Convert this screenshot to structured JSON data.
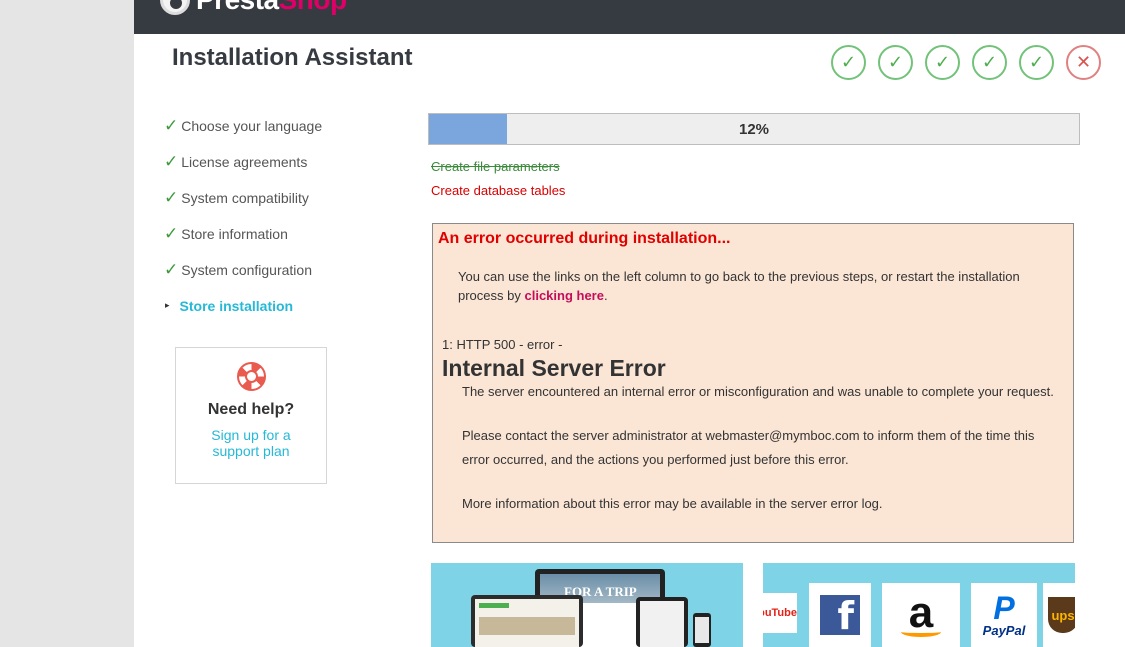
{
  "brand": {
    "logo_part1": "Presta",
    "logo_part2": "Shop"
  },
  "title": "Installation Assistant",
  "steps_indicator": [
    {
      "status": "done",
      "glyph": "✓"
    },
    {
      "status": "done",
      "glyph": "✓"
    },
    {
      "status": "done",
      "glyph": "✓"
    },
    {
      "status": "done",
      "glyph": "✓"
    },
    {
      "status": "done",
      "glyph": "✓"
    },
    {
      "status": "error",
      "glyph": "✕"
    }
  ],
  "nav": {
    "check_glyph": "✓",
    "arrow_glyph": "▸",
    "items": [
      {
        "label": "Choose your language"
      },
      {
        "label": "License agreements"
      },
      {
        "label": "System compatibility"
      },
      {
        "label": "Store information"
      },
      {
        "label": "System configuration"
      },
      {
        "label": "Store installation"
      }
    ]
  },
  "help": {
    "heading": "Need help?",
    "link_line1": "Sign up for a",
    "link_line2": "support plan",
    "icon": "lifebuoy-icon"
  },
  "progress": {
    "fraction": 0.12,
    "label": "12%"
  },
  "tasks": {
    "done": "Create file parameters",
    "failed": "Create database tables"
  },
  "error": {
    "title": "An error occurred during installation...",
    "message_prefix": "You can use the links on the left column to go back to the previous steps, or restart the installation process by ",
    "message_link": "clicking here",
    "message_suffix": ".",
    "http_line": "1: HTTP 500 - error -",
    "heading": "Internal Server Error",
    "p1": "The server encountered an internal error or misconfiguration and was unable to complete your request.",
    "p2": "Please contact the server administrator at webmaster@mymboc.com to inform them of the time this error occurred, and the actions you performed just before this error.",
    "p3": "More information about this error may be available in the server error log."
  },
  "banners": {
    "left_text": "FOR A TRIP",
    "brands": {
      "youtube": "ouTube",
      "facebook": "f",
      "amazon": "a",
      "paypal_mark": "P",
      "paypal": "PayPal",
      "ups": "ups"
    }
  },
  "colors": {
    "accent": "#25b9d7",
    "success": "#72c279",
    "error": "#e00000",
    "header": "#363a41"
  }
}
